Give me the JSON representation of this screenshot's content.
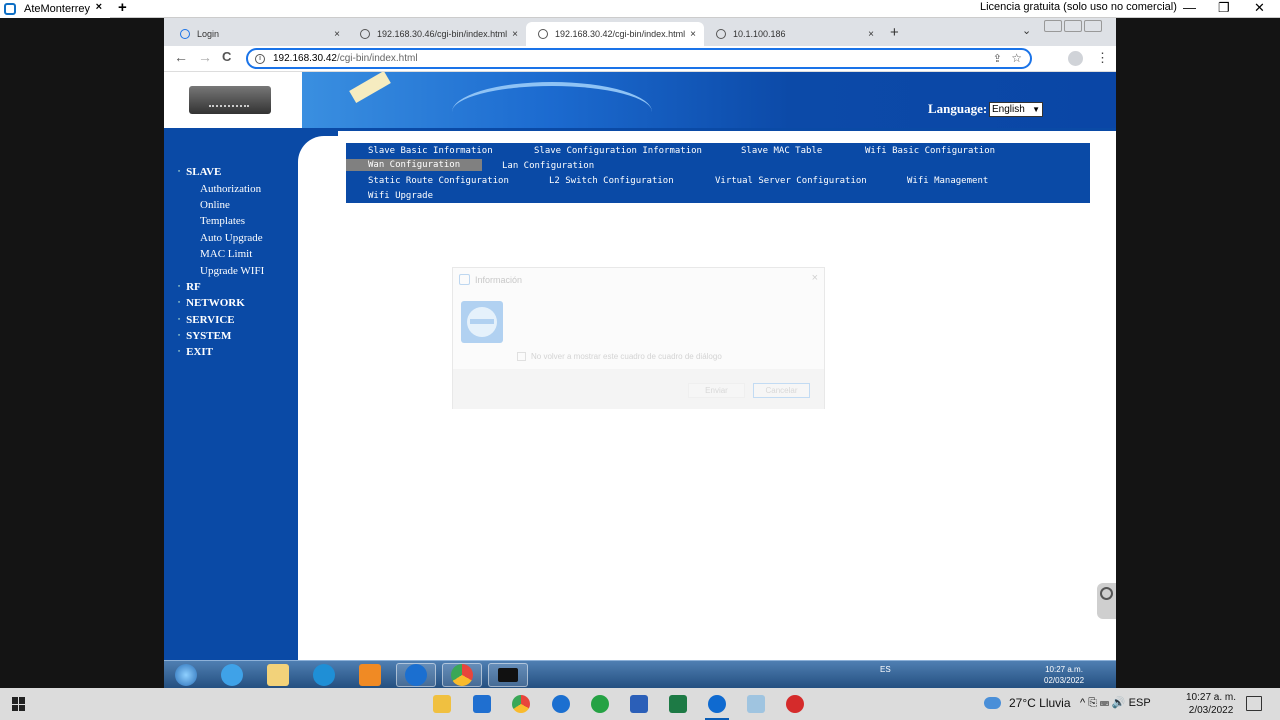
{
  "teamviewer": {
    "tab_title": "AteMonterrey",
    "tab_close": "×",
    "add": "+",
    "license": "Licencia gratuita (solo uso no comercial)",
    "min": "—",
    "max": "❐",
    "close": "✕"
  },
  "browser": {
    "tabs": [
      {
        "title": "Login",
        "close": "×"
      },
      {
        "title": "192.168.30.46/cgi-bin/index.html",
        "close": "×"
      },
      {
        "title": "192.168.30.42/cgi-bin/index.html",
        "close": "×"
      },
      {
        "title": "10.1.100.186",
        "close": "×"
      }
    ],
    "new_tab": "+",
    "tab_list": "⌄",
    "url_host": "192.168.30.42",
    "url_path": "/cgi-bin/index.html",
    "back": "←",
    "forward": "→",
    "reload": "C",
    "kebab": "⋮"
  },
  "page": {
    "language_label": "Language:",
    "language_value": "English",
    "sidebar": {
      "slave": "SLAVE",
      "sub_items": [
        "Authorization",
        "Online",
        "Templates",
        "Auto Upgrade",
        "MAC Limit",
        "Upgrade WIFI"
      ],
      "groups": [
        "RF",
        "NETWORK",
        "SERVICE",
        "SYSTEM",
        "EXIT"
      ]
    },
    "topnav": {
      "slave_basic": "Slave Basic Information",
      "slave_config": "Slave Configuration Information",
      "slave_mac": "Slave MAC Table",
      "wifi_basic": "Wifi Basic Configuration",
      "wan": "Wan Configuration",
      "lan": "Lan Configuration",
      "static_route": "Static Route Configuration",
      "l2_switch": "L2 Switch Configuration",
      "virtual_server": "Virtual Server Configuration",
      "wifi_mgmt": "Wifi Management",
      "wifi_upgrade": "Wifi Upgrade"
    }
  },
  "dialog": {
    "title": "Información",
    "close": "×",
    "checkbox": "No volver a mostrar este cuadro de cuadro de diálogo",
    "send": "Enviar",
    "cancel": "Cancelar"
  },
  "remote_taskbar": {
    "tray_lang": "ES",
    "time": "10:27 a.m.",
    "date": "02/03/2022"
  },
  "local_taskbar": {
    "weather": "27°C  Lluvia",
    "tray": "^  ⎘  ⌨  🔊  ESP",
    "time": "10:27 a. m.",
    "date": "2/03/2022"
  },
  "colors": {
    "nav_blue": "#0a4aa6",
    "selected_gray": "#808080",
    "chrome_accent": "#1a73e8"
  }
}
